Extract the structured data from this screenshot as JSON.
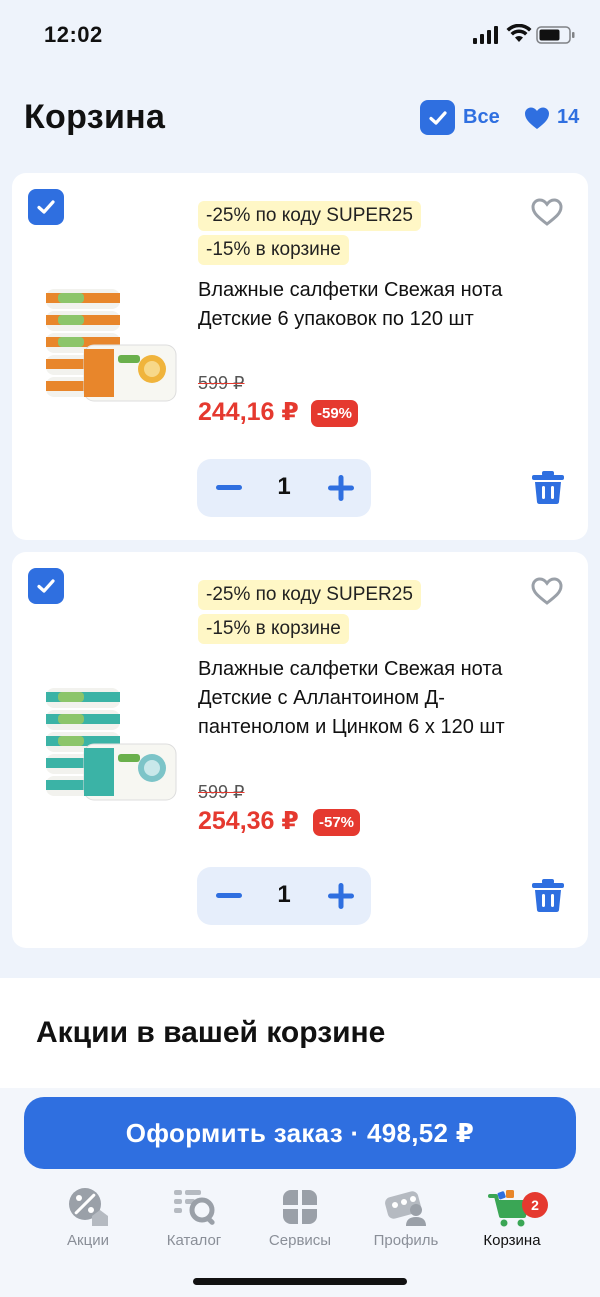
{
  "status_bar": {
    "time": "12:02"
  },
  "header": {
    "title": "Корзина",
    "select_all_label": "Все",
    "favorites_count": "14"
  },
  "colors": {
    "accent": "#2f6fe0",
    "price_red": "#e5392f",
    "promo_bg": "#fff7c6"
  },
  "cart": {
    "items": [
      {
        "promo_code": "-25% по коду SUPER25",
        "promo_cart": "-15% в корзине",
        "name": "Влажные салфетки Свежая нота Детские 6 упаковок по 120 шт",
        "old_price": "599 ₽",
        "price": "244,16 ₽",
        "discount": "-59%",
        "quantity": "1"
      },
      {
        "promo_code": "-25% по коду SUPER25",
        "promo_cart": "-15% в корзине",
        "name": "Влажные салфетки Свежая нота Детские с Аллантоином Д-пантенолом и Цинком 6 х 120 шт",
        "old_price": "599 ₽",
        "price": "254,36 ₽",
        "discount": "-57%",
        "quantity": "1"
      }
    ]
  },
  "promos_section": {
    "title": "Акции в вашей корзине"
  },
  "checkout": {
    "label": "Оформить заказ · 498,52 ₽"
  },
  "tabbar": {
    "items": [
      {
        "label": "Акции",
        "icon": "percent-tag-icon"
      },
      {
        "label": "Каталог",
        "icon": "catalog-search-icon"
      },
      {
        "label": "Сервисы",
        "icon": "services-grid-icon"
      },
      {
        "label": "Профиль",
        "icon": "profile-card-icon"
      },
      {
        "label": "Корзина",
        "icon": "cart-icon"
      }
    ],
    "cart_badge": "2"
  }
}
